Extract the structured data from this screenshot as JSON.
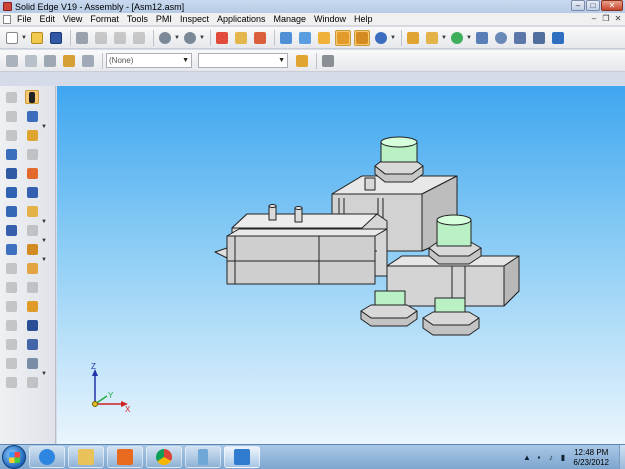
{
  "window": {
    "title": "Solid Edge V19 - Assembly - [Asm12.asm]",
    "controls": {
      "minimize": "–",
      "maximize": "□",
      "close": "✕"
    }
  },
  "menubar": {
    "items": [
      "File",
      "Edit",
      "View",
      "Format",
      "Tools",
      "PMI",
      "Inspect",
      "Applications",
      "Manage",
      "Window",
      "Help"
    ],
    "doc_controls": {
      "minimize": "–",
      "restore": "❐",
      "close": "✕"
    }
  },
  "toolbar2": {
    "layer_combo_value": "(None)",
    "style_combo_value": ""
  },
  "triad": {
    "x_label": "X",
    "y_label": "Y",
    "z_label": "Z"
  },
  "taskbar": {
    "clock_time": "12:48 PM",
    "clock_date": "6/23/2012",
    "apps": [
      "ie-icon",
      "explorer-icon",
      "media-player-icon",
      "chrome-icon",
      "phone-icon",
      "solid-edge-icon"
    ]
  },
  "colors": {
    "viewport_top": "#3fa6f0",
    "viewport_bottom": "#eaf5fd",
    "part_gray": "#d8d8d8",
    "part_edge": "#222222",
    "nut_green": "#b9f0c4",
    "active_tool": "#f6c970"
  }
}
